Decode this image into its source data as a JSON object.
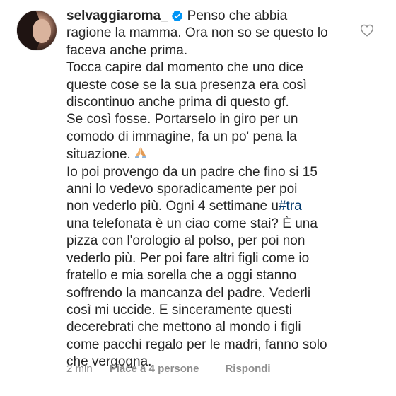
{
  "comment": {
    "username": "selvaggiaroma_",
    "lines": [
      "Penso che abbia",
      "ragione la mamma. Ora non so se questo lo",
      "faceva anche prima.",
      "Tocca capire dal momento che uno dice",
      "queste cose se la sua presenza era così",
      "discontinuo  anche prima di questo gf.",
      "Se così fosse. Portarselo in giro per un",
      "comodo di immagine, fa un po' pena la",
      "situazione.",
      "Io poi provengo da un padre che fino si 15",
      "anni lo vedevo sporadicamente per poi",
      "non vederlo più. Ogni 4 settimane u",
      "una telefonata è un ciao come stai? È una",
      "pizza con l'orologio al polso, per poi non",
      "vederlo più. Per poi fare altri figli come io",
      "fratello e mia sorella che a oggi stanno",
      "soffrendo la mancanza del padre. Vederli",
      "così mi uccide. E sinceramente questi",
      "decerebrati che mettono al mondo i figli",
      "come pacchi regalo per le madri, fanno solo",
      "che vergogna."
    ],
    "hashtag": "#tra",
    "emoji_icon": "folded-hands-icon"
  },
  "meta": {
    "time": "2 min",
    "likes": "Piace a 4 persone",
    "reply": "Rispondi"
  },
  "colors": {
    "text": "#262626",
    "meta": "#8e8e8e",
    "verified": "#0095f6",
    "hashtag": "#00376b"
  }
}
